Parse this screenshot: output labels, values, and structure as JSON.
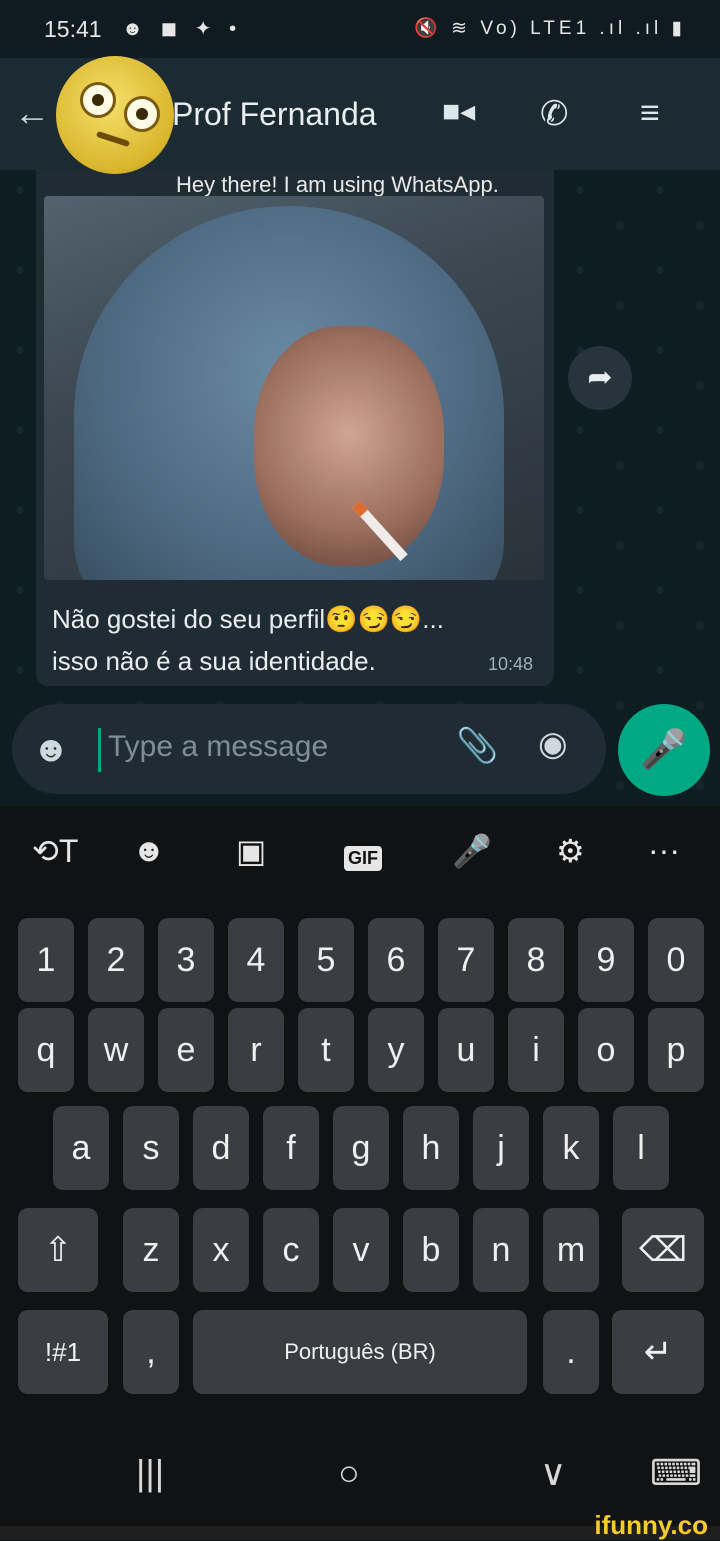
{
  "status_bar": {
    "time": "15:41",
    "left_icons": "☻ ◼ ✦ •",
    "right_icons": "🔇 ≋ Vo) LTE1 .ıl .ıl ▮"
  },
  "header": {
    "back": "←",
    "contact_name": "Prof Fernanda",
    "video_icon": "■◂",
    "call_icon": "✆",
    "menu_icon": "≡"
  },
  "chat": {
    "status_caption": "Hey there! I am using WhatsApp.",
    "forward_icon": "➦",
    "message_line1": "Não gostei do seu perfil🤨😏😏...",
    "message_line2": "isso não é a sua identidade.",
    "message_time": "10:48"
  },
  "input": {
    "emoji_icon": "☻",
    "placeholder": "Type a message",
    "attach_icon": "📎",
    "camera_icon": "◉",
    "mic_icon": "🎤"
  },
  "keyboard": {
    "toolbar": [
      "⟲T",
      "☻",
      "▣",
      "GIF",
      "🎤",
      "⚙",
      "···"
    ],
    "numbers": [
      "1",
      "2",
      "3",
      "4",
      "5",
      "6",
      "7",
      "8",
      "9",
      "0"
    ],
    "row1": [
      "q",
      "w",
      "e",
      "r",
      "t",
      "y",
      "u",
      "i",
      "o",
      "p"
    ],
    "row2": [
      "a",
      "s",
      "d",
      "f",
      "g",
      "h",
      "j",
      "k",
      "l"
    ],
    "row3": [
      "⇧",
      "z",
      "x",
      "c",
      "v",
      "b",
      "n",
      "m",
      "⌫"
    ],
    "row4": [
      "!#1",
      ",",
      "Português (BR)",
      ".",
      "↵"
    ]
  },
  "nav": {
    "recent": "|||",
    "home": "○",
    "back": "∨",
    "keyboard": "⌨"
  },
  "watermark": "ifunny.co"
}
